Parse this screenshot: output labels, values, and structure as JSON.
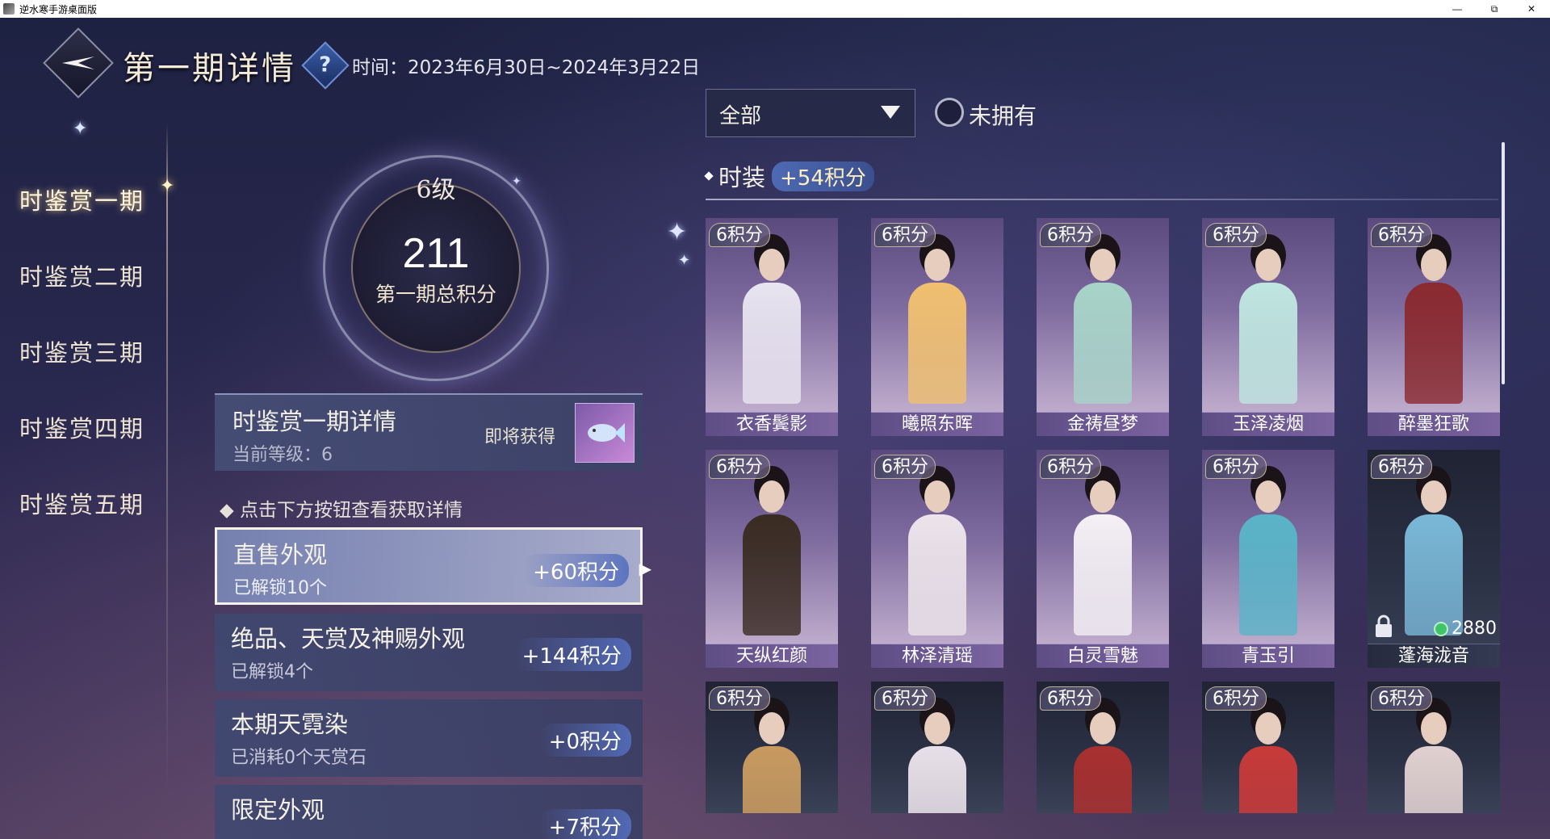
{
  "window": {
    "title": "逆水寒手游桌面版",
    "controls": [
      "minimize-icon",
      "restore-icon",
      "close-icon"
    ]
  },
  "header": {
    "title": "第一期详情",
    "help_icon": "question-icon",
    "time_label": "时间：2023年6月30日~2024年3月22日"
  },
  "nav": {
    "items": [
      {
        "label": "时鉴赏一期",
        "active": true
      },
      {
        "label": "时鉴赏二期",
        "active": false
      },
      {
        "label": "时鉴赏三期",
        "active": false
      },
      {
        "label": "时鉴赏四期",
        "active": false
      },
      {
        "label": "时鉴赏五期",
        "active": false
      }
    ]
  },
  "score_ring": {
    "level": "6级",
    "score": "211",
    "label": "第一期总积分"
  },
  "detail": {
    "title": "时鉴赏一期详情",
    "current_level": "当前等级：6",
    "upcoming": "即将获得",
    "reward_icon": "fish-icon"
  },
  "hint": "点击下方按钮查看获取详情",
  "categories": [
    {
      "title": "直售外观",
      "sub": "已解锁10个",
      "points": "+60积分",
      "selected": true
    },
    {
      "title": "绝品、天赏及神赐外观",
      "sub": "已解锁4个",
      "points": "+144积分",
      "selected": false
    },
    {
      "title": "本期天霓染",
      "sub": "已消耗0个天赏石",
      "points": "+0积分",
      "selected": false
    },
    {
      "title": "限定外观",
      "sub": "",
      "points": "+7积分",
      "selected": false
    }
  ],
  "filter": {
    "selected": "全部",
    "unowned_label": "未拥有",
    "unowned_checked": false
  },
  "section": {
    "name": "时装",
    "points": "+54积分"
  },
  "items": [
    {
      "badge": "6积分",
      "name": "衣香鬓影",
      "color": "#e8e4f0",
      "dark": false
    },
    {
      "badge": "6积分",
      "name": "曦照东晖",
      "color": "#f0c070",
      "dark": false
    },
    {
      "badge": "6积分",
      "name": "金祷昼梦",
      "color": "#a8d4c8",
      "dark": false
    },
    {
      "badge": "6积分",
      "name": "玉泽凌烟",
      "color": "#bfe6e0",
      "dark": false
    },
    {
      "badge": "6积分",
      "name": "醉墨狂歌",
      "color": "#8a2a30",
      "dark": false
    },
    {
      "badge": "6积分",
      "name": "天纵红颜",
      "color": "#3a2c22",
      "dark": false
    },
    {
      "badge": "6积分",
      "name": "林泽清瑶",
      "color": "#ece4ea",
      "dark": false
    },
    {
      "badge": "6积分",
      "name": "白灵雪魅",
      "color": "#f4f0f4",
      "dark": false
    },
    {
      "badge": "6积分",
      "name": "青玉引",
      "color": "#5ab4c8",
      "dark": false
    },
    {
      "badge": "6积分",
      "name": "蓬海泷音",
      "color": "#7ab8d8",
      "dark": true,
      "price": "2880",
      "locked": true
    },
    {
      "badge": "6积分",
      "name": "",
      "color": "#c89a60",
      "dark": true
    },
    {
      "badge": "6积分",
      "name": "",
      "color": "#e8e0e8",
      "dark": true
    },
    {
      "badge": "6积分",
      "name": "",
      "color": "#a83030",
      "dark": true
    },
    {
      "badge": "6积分",
      "name": "",
      "color": "#c83a3a",
      "dark": true
    },
    {
      "badge": "6积分",
      "name": "",
      "color": "#e0d0d0",
      "dark": true
    }
  ]
}
